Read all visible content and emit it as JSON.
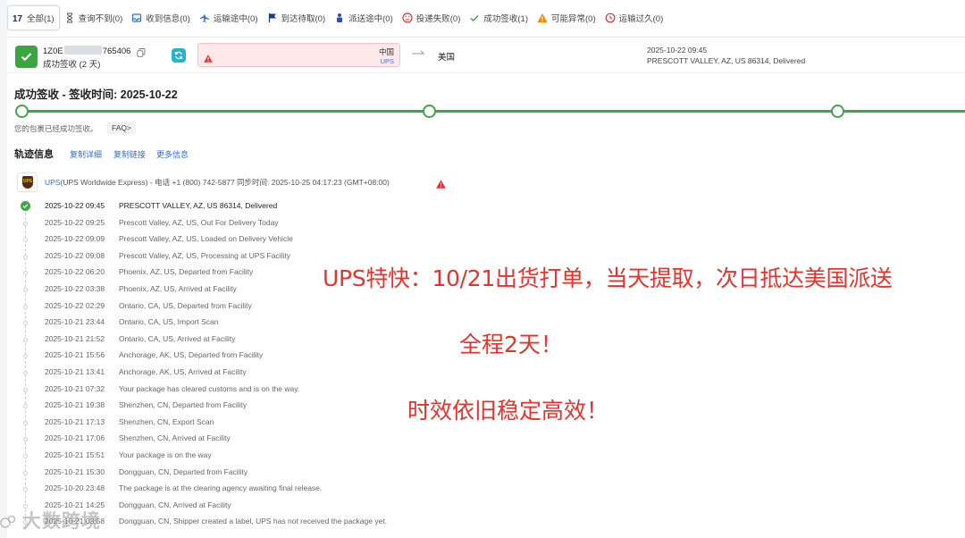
{
  "tabs": [
    {
      "label": "全部(1)",
      "icon": "seventeen-logo-icon",
      "active": true
    },
    {
      "label": "查询不到(0)",
      "icon": "hourglass-icon"
    },
    {
      "label": "收到信息(0)",
      "icon": "inbox-icon"
    },
    {
      "label": "运输途中(0)",
      "icon": "plane-icon"
    },
    {
      "label": "到达待取(0)",
      "icon": "flag-icon"
    },
    {
      "label": "派送途中(0)",
      "icon": "courier-icon"
    },
    {
      "label": "投递失败(0)",
      "icon": "sad-face-icon"
    },
    {
      "label": "成功签收(1)",
      "icon": "check-icon"
    },
    {
      "label": "可能异常(0)",
      "icon": "warning-icon"
    },
    {
      "label": "运输过久(0)",
      "icon": "clock-icon"
    }
  ],
  "summary": {
    "tracking_prefix": "1Z0E",
    "tracking_suffix": "765406",
    "status": "成功签收 (2 天)",
    "origin_country": "中国",
    "origin_carrier": "UPS",
    "destination": "美国",
    "last_time": "2025-10-22 09:45",
    "last_event": "PRESCOTT VALLEY, AZ, US 86314, Delivered"
  },
  "delivery": {
    "title": "成功签收 - 签收时间: 2025-10-22",
    "progress_percent": 100,
    "note": "您的包裹已经成功签收。",
    "faq": "FAQ>"
  },
  "track": {
    "title": "轨迹信息",
    "links": [
      "复制详细",
      "复制链接",
      "更多信息"
    ],
    "carrier_name": "UPS",
    "carrier_info": "(UPS Worldwide Express) - 电话 +1 (800) 742-5877   同步时间: 2025-10-25 04:17:23 (GMT+08:00)"
  },
  "events": [
    {
      "time": "2025-10-22 09:45",
      "desc": "PRESCOTT VALLEY, AZ, US 86314, Delivered"
    },
    {
      "time": "2025-10-22 09:25",
      "desc": "Prescott Valley, AZ, US, Out For Delivery Today"
    },
    {
      "time": "2025-10-22 09:09",
      "desc": "Prescott Valley, AZ, US, Loaded on Delivery Vehicle"
    },
    {
      "time": "2025-10-22 09:08",
      "desc": "Prescott Valley, AZ, US, Processing at UPS Facility"
    },
    {
      "time": "2025-10-22 06:20",
      "desc": "Phoenix, AZ, US, Departed from Facility"
    },
    {
      "time": "2025-10-22 03:38",
      "desc": "Phoenix, AZ, US, Arrived at Facility"
    },
    {
      "time": "2025-10-22 02:29",
      "desc": "Ontario, CA, US, Departed from Facility"
    },
    {
      "time": "2025-10-21 23:44",
      "desc": "Ontario, CA, US, Import Scan"
    },
    {
      "time": "2025-10-21 21:52",
      "desc": "Ontario, CA, US, Arrived at Facility"
    },
    {
      "time": "2025-10-21 15:56",
      "desc": "Anchorage, AK, US, Departed from Facility"
    },
    {
      "time": "2025-10-21 13:41",
      "desc": "Anchorage, AK, US, Arrived at Facility"
    },
    {
      "time": "2025-10-21 07:32",
      "desc": "Your package has cleared customs and is on the way."
    },
    {
      "time": "2025-10-21 19:38",
      "desc": "Shenzhen, CN, Departed from Facility"
    },
    {
      "time": "2025-10-21 17:13",
      "desc": "Shenzhen, CN, Export Scan"
    },
    {
      "time": "2025-10-21 17:06",
      "desc": "Shenzhen, CN, Arrived at Facility"
    },
    {
      "time": "2025-10-21 15:51",
      "desc": "Your package is on the way"
    },
    {
      "time": "2025-10-21 15:30",
      "desc": "Dongguan, CN, Departed from Facility"
    },
    {
      "time": "2025-10-20 23:48",
      "desc": "The package is at the clearing agency awaiting final release."
    },
    {
      "time": "2025-10-21 14:25",
      "desc": "Dongguan, CN, Arrived at Facility"
    },
    {
      "time": "2025-10-21 03:58",
      "desc": "Dongguan, CN, Shipper created a label, UPS has not received the package yet."
    }
  ],
  "overlay": {
    "line1": "UPS特快：10/21出货打单，当天提取，次日抵达美国派送",
    "line2": "全程2天！",
    "line3": "时效依旧稳定高效！"
  },
  "watermark": "大数跨境",
  "colors": {
    "success": "#3fa748",
    "link": "#2f6fd1",
    "overlay_red": "#e8322a",
    "warning_red": "#e0323a"
  }
}
